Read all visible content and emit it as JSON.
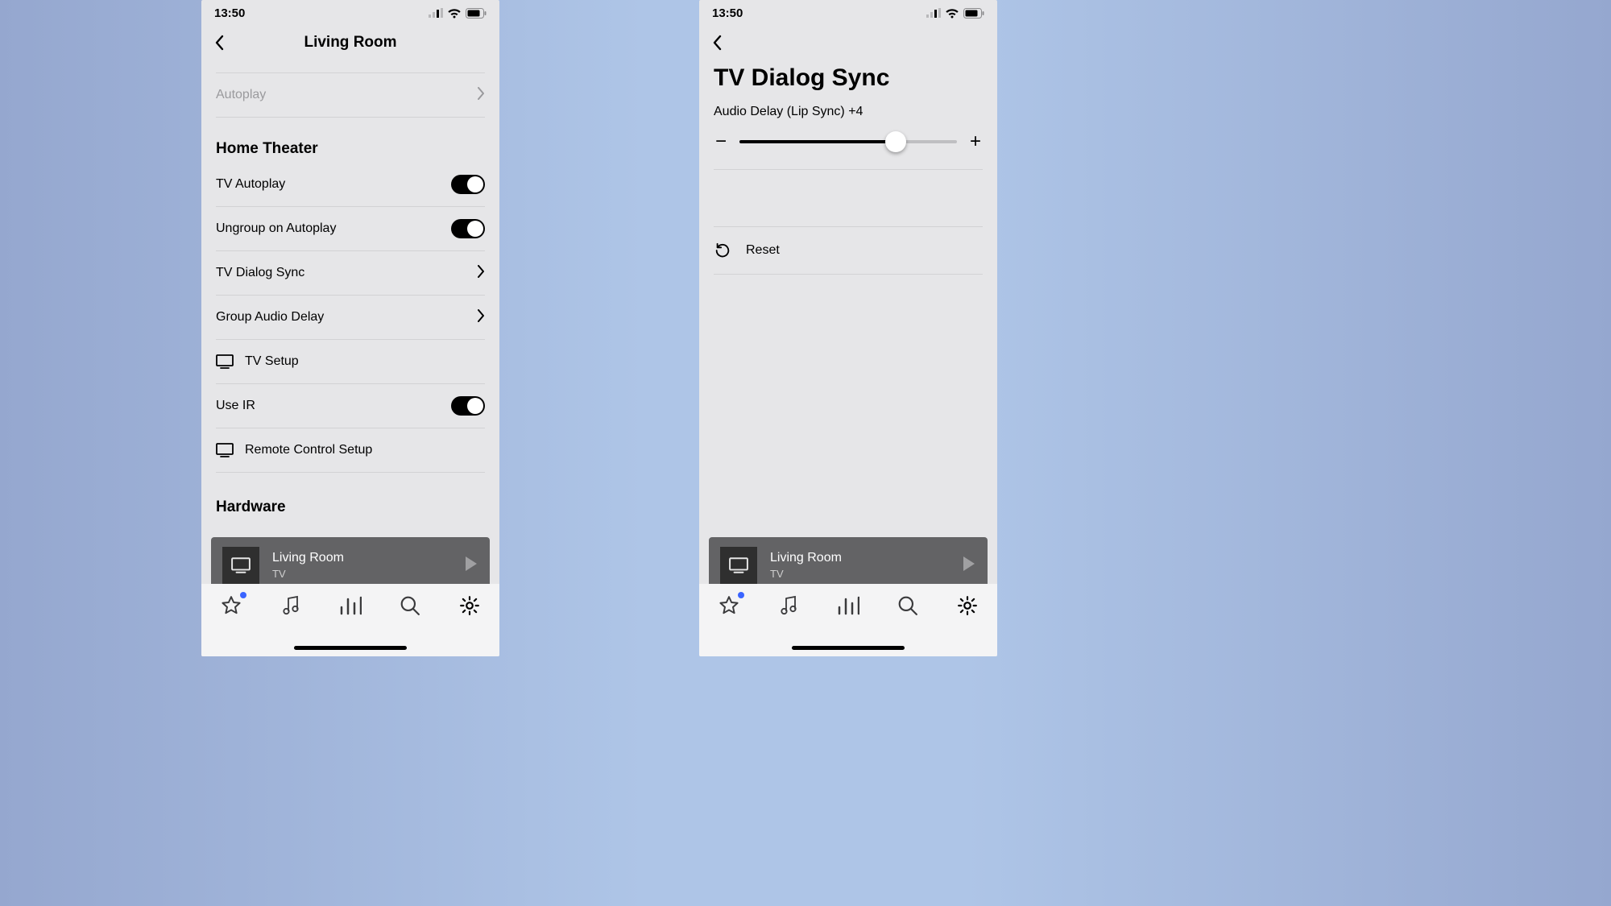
{
  "status": {
    "time": "13:50"
  },
  "left": {
    "title": "Living Room",
    "autoplay": "Autoplay",
    "section_home_theater": "Home Theater",
    "tv_autoplay": "TV Autoplay",
    "ungroup_autoplay": "Ungroup on Autoplay",
    "tv_dialog_sync": "TV Dialog Sync",
    "group_audio_delay": "Group Audio Delay",
    "tv_setup": "TV Setup",
    "use_ir": "Use IR",
    "remote_setup": "Remote Control Setup",
    "section_hardware": "Hardware"
  },
  "right": {
    "title": "TV Dialog Sync",
    "slider_label": "Audio Delay (Lip Sync) +4",
    "slider_percent": 72,
    "reset": "Reset"
  },
  "miniplayer": {
    "title": "Living Room",
    "sub": "TV"
  }
}
